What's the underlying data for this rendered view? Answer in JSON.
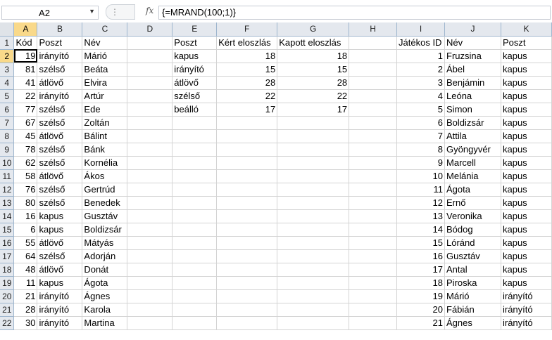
{
  "name_box": {
    "value": "A2"
  },
  "formula_bar": {
    "fx_label": "fx",
    "value": "{=MRAND(100;1)}"
  },
  "columns": [
    "A",
    "B",
    "C",
    "D",
    "E",
    "F",
    "G",
    "H",
    "I",
    "J",
    "K"
  ],
  "rows": [
    {
      "n": "1",
      "A": "Kód",
      "B": "Poszt",
      "C": "Név",
      "E": "Poszt",
      "F": "Kért eloszlás",
      "G": "Kapott eloszlás",
      "I": "Játékos ID",
      "J": "Név",
      "K": "Poszt"
    },
    {
      "n": "2",
      "A": "19",
      "B": "irányító",
      "C": "Márió",
      "E": "kapus",
      "F": "18",
      "G": "18",
      "I": "1",
      "J": "Fruzsina",
      "K": "kapus"
    },
    {
      "n": "3",
      "A": "81",
      "B": "szélső",
      "C": "Beáta",
      "E": "irányító",
      "F": "15",
      "G": "15",
      "I": "2",
      "J": "Ábel",
      "K": "kapus"
    },
    {
      "n": "4",
      "A": "41",
      "B": "átlövő",
      "C": "Elvira",
      "E": "átlövő",
      "F": "28",
      "G": "28",
      "I": "3",
      "J": "Benjámin",
      "K": "kapus"
    },
    {
      "n": "5",
      "A": "22",
      "B": "irányító",
      "C": "Artúr",
      "E": "szélső",
      "F": "22",
      "G": "22",
      "I": "4",
      "J": "Leóna",
      "K": "kapus"
    },
    {
      "n": "6",
      "A": "77",
      "B": "szélső",
      "C": "Ede",
      "E": "beálló",
      "F": "17",
      "G": "17",
      "I": "5",
      "J": "Simon",
      "K": "kapus"
    },
    {
      "n": "7",
      "A": "67",
      "B": "szélső",
      "C": "Zoltán",
      "I": "6",
      "J": "Boldizsár",
      "K": "kapus"
    },
    {
      "n": "8",
      "A": "45",
      "B": "átlövő",
      "C": "Bálint",
      "I": "7",
      "J": "Attila",
      "K": "kapus"
    },
    {
      "n": "9",
      "A": "78",
      "B": "szélső",
      "C": "Bánk",
      "I": "8",
      "J": "Gyöngyvér",
      "K": "kapus"
    },
    {
      "n": "10",
      "A": "62",
      "B": "szélső",
      "C": "Kornélia",
      "I": "9",
      "J": "Marcell",
      "K": "kapus"
    },
    {
      "n": "11",
      "A": "58",
      "B": "átlövő",
      "C": "Ákos",
      "I": "10",
      "J": "Melánia",
      "K": "kapus"
    },
    {
      "n": "12",
      "A": "76",
      "B": "szélső",
      "C": "Gertrúd",
      "I": "11",
      "J": "Ágota",
      "K": "kapus"
    },
    {
      "n": "13",
      "A": "80",
      "B": "szélső",
      "C": "Benedek",
      "I": "12",
      "J": "Ernő",
      "K": "kapus"
    },
    {
      "n": "14",
      "A": "16",
      "B": "kapus",
      "C": "Gusztáv",
      "I": "13",
      "J": "Veronika",
      "K": "kapus"
    },
    {
      "n": "15",
      "A": "6",
      "B": "kapus",
      "C": "Boldizsár",
      "I": "14",
      "J": "Bódog",
      "K": "kapus"
    },
    {
      "n": "16",
      "A": "55",
      "B": "átlövő",
      "C": "Mátyás",
      "I": "15",
      "J": "Lóránd",
      "K": "kapus"
    },
    {
      "n": "17",
      "A": "64",
      "B": "szélső",
      "C": "Adorján",
      "I": "16",
      "J": "Gusztáv",
      "K": "kapus"
    },
    {
      "n": "18",
      "A": "48",
      "B": "átlövő",
      "C": "Donát",
      "I": "17",
      "J": "Antal",
      "K": "kapus"
    },
    {
      "n": "19",
      "A": "11",
      "B": "kapus",
      "C": "Ágota",
      "I": "18",
      "J": "Piroska",
      "K": "kapus"
    },
    {
      "n": "20",
      "A": "21",
      "B": "irányító",
      "C": "Ágnes",
      "I": "19",
      "J": "Márió",
      "K": "irányító"
    },
    {
      "n": "21",
      "A": "28",
      "B": "irányító",
      "C": "Karola",
      "I": "20",
      "J": "Fábián",
      "K": "irányító"
    },
    {
      "n": "22",
      "A": "30",
      "B": "irányító",
      "C": "Martina",
      "I": "21",
      "J": "Ágnes",
      "K": "irányító"
    }
  ],
  "active_cell": {
    "row": "2",
    "col": "A"
  },
  "colors": {
    "header_bg": "#e4e8ee",
    "header_selected_bg": "#f9d98a",
    "gridline": "#d4d4d4"
  }
}
